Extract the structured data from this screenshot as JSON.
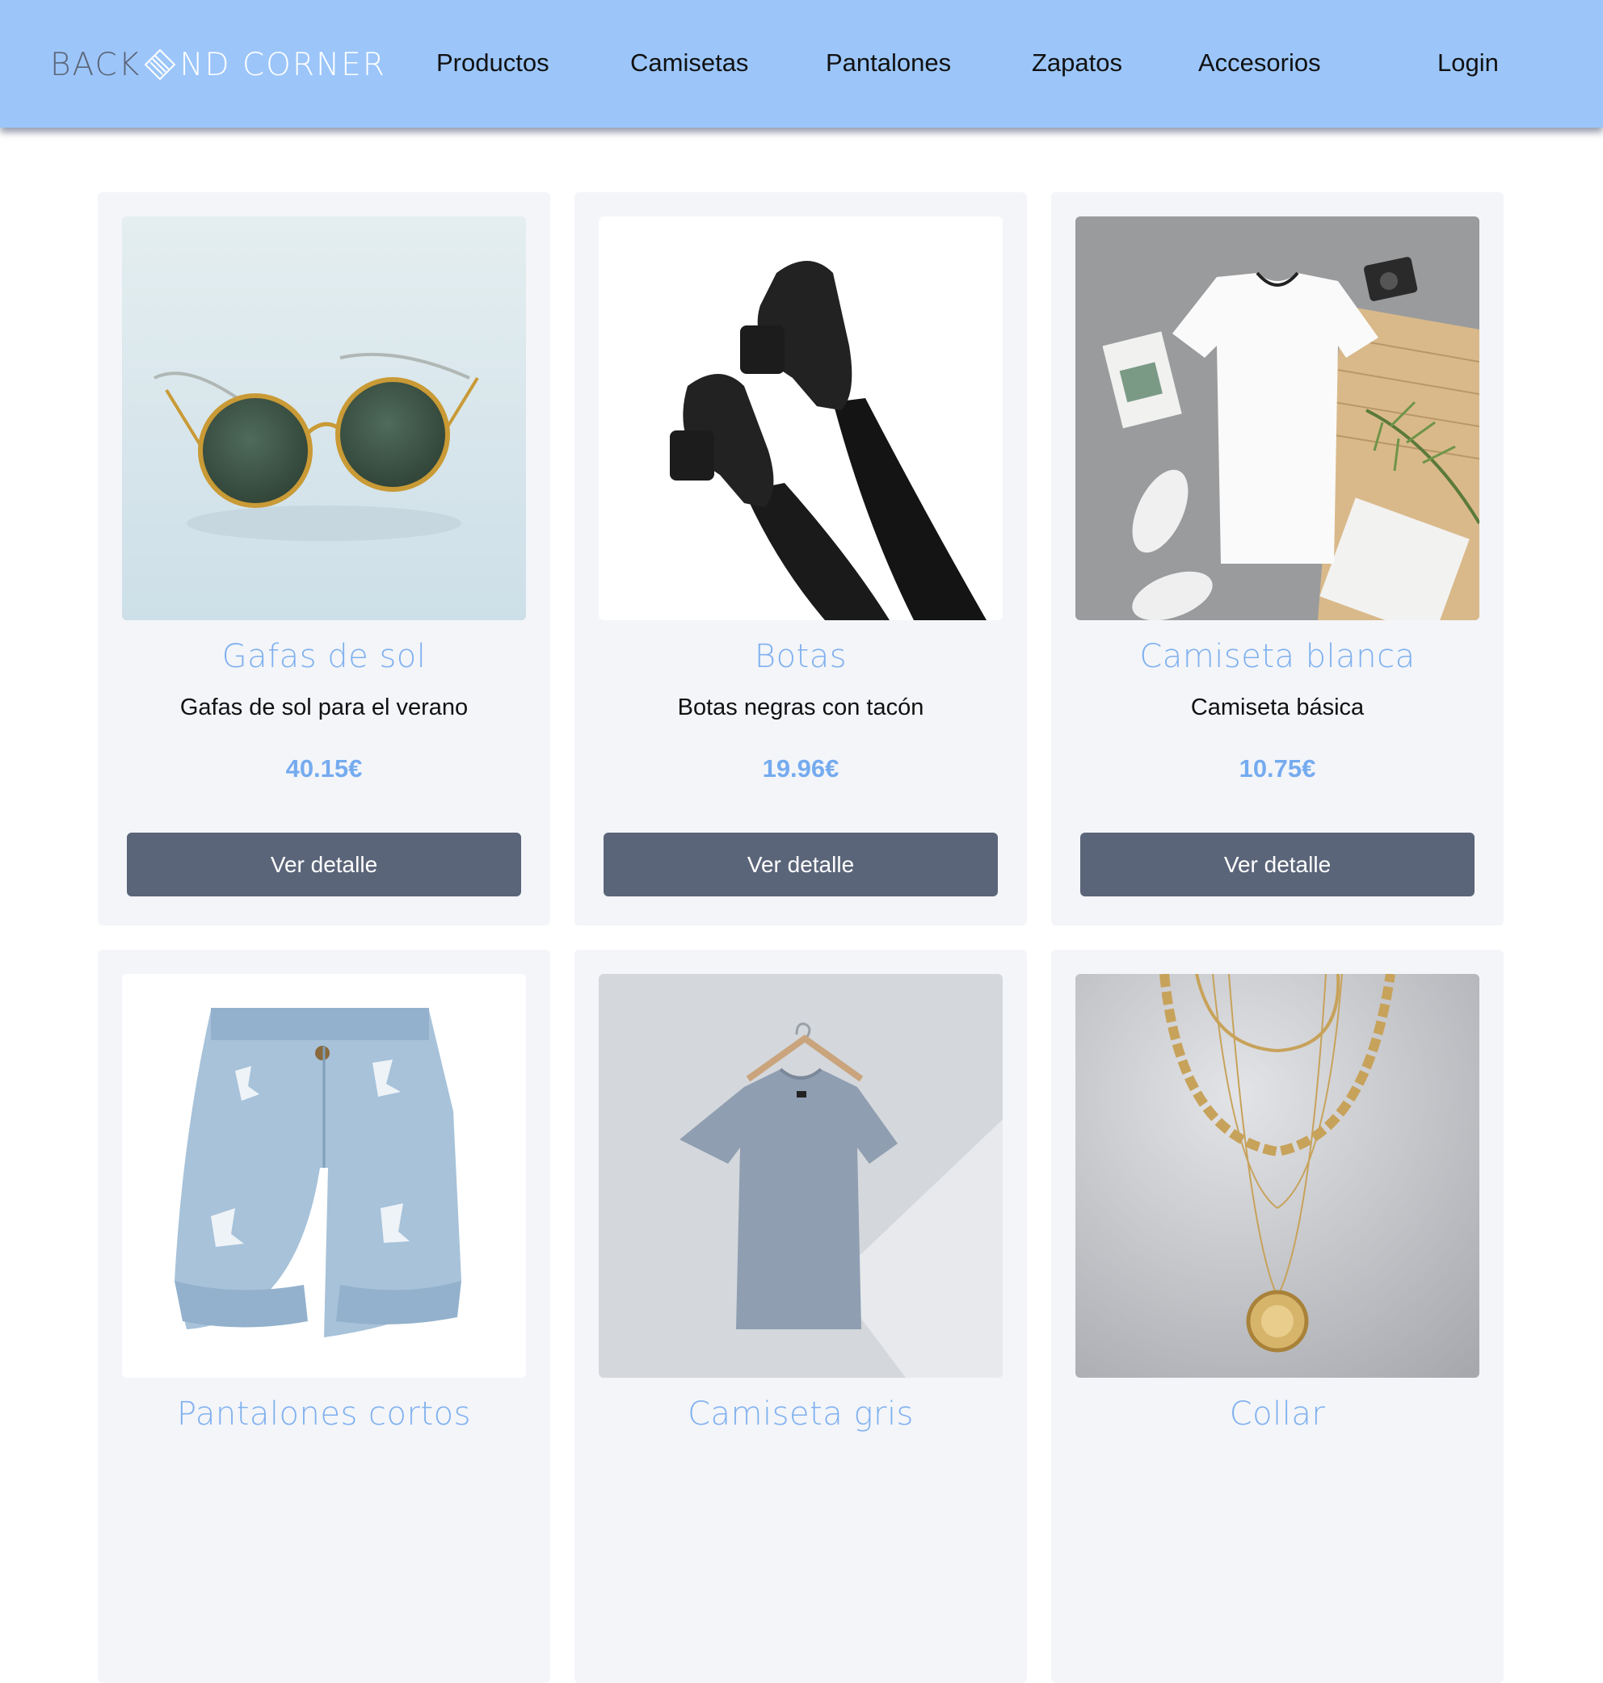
{
  "header": {
    "logo_text_left": "BACK",
    "logo_text_right": "ND CORNER",
    "nav": [
      "Productos",
      "Camisetas",
      "Pantalones",
      "Zapatos",
      "Accesorios"
    ],
    "login_label": "Login"
  },
  "colors": {
    "header_bg": "#9cc6fa",
    "card_bg": "#f3f5f9",
    "title_blue": "#7fb0ef",
    "price_blue": "#75abef",
    "button_bg": "#5b6579"
  },
  "products": [
    {
      "title": "Gafas de sol",
      "description": "Gafas de sol para el verano",
      "price": "40.15€",
      "button": "Ver detalle",
      "image": "sunglasses-photo"
    },
    {
      "title": "Botas",
      "description": "Botas negras con tacón",
      "price": "19.96€",
      "button": "Ver detalle",
      "image": "black-boots-photo"
    },
    {
      "title": "Camiseta blanca",
      "description": "Camiseta básica",
      "price": "10.75€",
      "button": "Ver detalle",
      "image": "white-tshirt-photo"
    },
    {
      "title": "Pantalones cortos",
      "description": "",
      "price": "",
      "button": "",
      "image": "denim-shorts-photo"
    },
    {
      "title": "Camiseta gris",
      "description": "",
      "price": "",
      "button": "",
      "image": "grey-tshirt-photo"
    },
    {
      "title": "Collar",
      "description": "",
      "price": "",
      "button": "",
      "image": "gold-necklace-photo"
    }
  ]
}
